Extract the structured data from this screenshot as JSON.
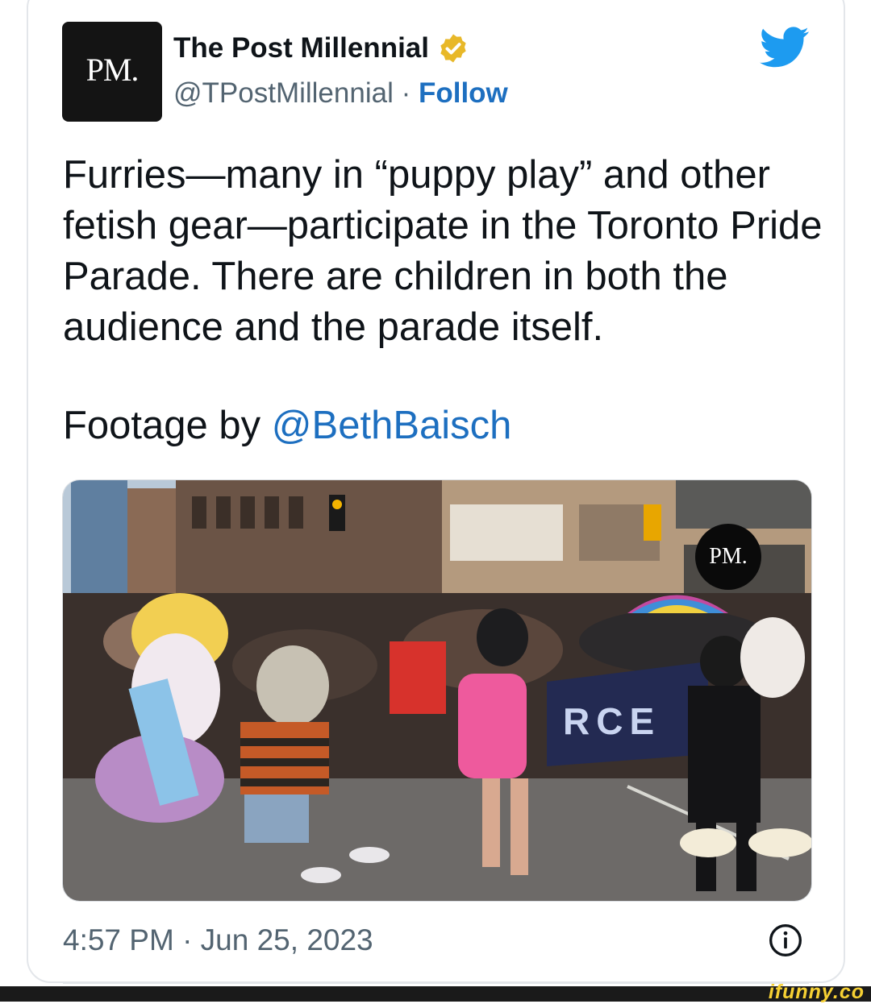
{
  "account": {
    "avatar_text": "PM.",
    "name": "The Post Millennial",
    "handle": "@TPostMillennial",
    "separator": "·",
    "follow_label": "Follow"
  },
  "tweet": {
    "text": "Furries—many in “puppy play” and other fetish gear—participate in the Toronto Pride Parade. There are children in both the audience and the parade itself.",
    "credit_prefix": "Footage by ",
    "credit_mention": "@BethBaisch"
  },
  "media": {
    "watermark": "PM.",
    "banner_text": "RCE"
  },
  "footer": {
    "timestamp": "4:57 PM · Jun 25, 2023"
  },
  "site_watermark": "ifunny.co",
  "colors": {
    "link": "#1d6fc0",
    "twitter_blue": "#1d9bf0",
    "verified_gold": "#e8b829"
  },
  "icons": [
    "verified-badge-icon",
    "twitter-bird-icon",
    "info-icon"
  ]
}
